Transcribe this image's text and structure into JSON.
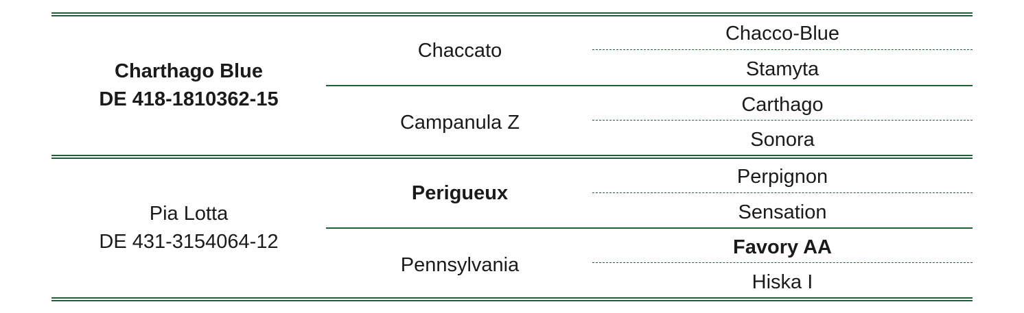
{
  "table": {
    "horse": [
      {
        "name": "Charthago Blue",
        "reg": "DE 418-1810362-15",
        "bold": true
      },
      {
        "name": "Pia Lotta",
        "reg": "DE 431-3154064-12",
        "bold": false
      }
    ],
    "parents": [
      {
        "name": "Chaccato",
        "bold": false
      },
      {
        "name": "Campanula Z",
        "bold": false
      },
      {
        "name": "Perigueux",
        "bold": true
      },
      {
        "name": "Pennsylvania",
        "bold": false
      }
    ],
    "grandparents": [
      {
        "name": "Chacco-Blue",
        "bold": false
      },
      {
        "name": "Stamyta",
        "bold": false
      },
      {
        "name": "Carthago",
        "bold": false
      },
      {
        "name": "Sonora",
        "bold": false
      },
      {
        "name": "Perpignon",
        "bold": false
      },
      {
        "name": "Sensation",
        "bold": false
      },
      {
        "name": "Favory AA",
        "bold": true
      },
      {
        "name": "Hiska I",
        "bold": false
      }
    ],
    "rule_color": "#1f5e34"
  }
}
